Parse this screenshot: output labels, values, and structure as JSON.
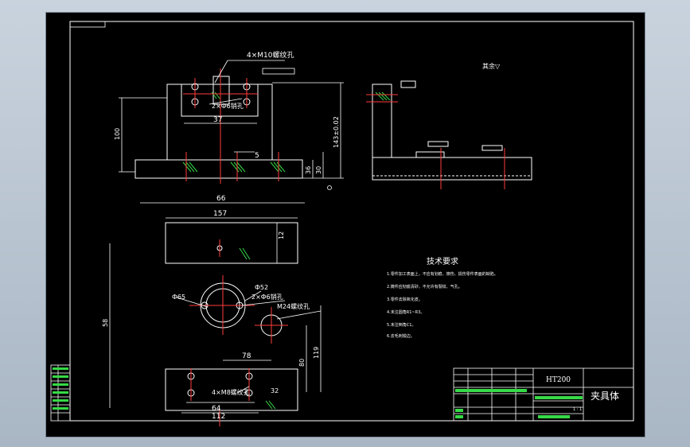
{
  "colors": {
    "background": "#000000",
    "part_outline": "#ffffff",
    "dimension": "#ffffff",
    "centerline": "#ff3b3b",
    "hatch": "#36d946",
    "annotation": "#ffffff",
    "title_block_green": "#36d946"
  },
  "front_view": {
    "callout_top_holes": "4×M10螺纹孔",
    "callout_pins": "2×Ф6销孔",
    "dim_width": "37",
    "dim_height": "100",
    "dim_overall_height": "143±0.02",
    "dim_step": "5",
    "dim_base_a": "36",
    "dim_base_b": "30"
  },
  "side_view": {
    "surface_mark": "其余▽"
  },
  "top_view": {
    "dim_overall_width": "66",
    "dim_slot_width": "157",
    "dim_slot_height": "12",
    "dim_bore": "Ф65",
    "dim_pin": "Ф52",
    "callout_pins": "2×Ф6销孔",
    "callout_m24": "M24螺纹孔",
    "dim_78": "78",
    "dim_overall_height": "58",
    "dim_80": "80",
    "dim_119": "119",
    "callout_bottom_holes": "4×M8螺纹孔",
    "dim_64": "64",
    "dim_112": "112",
    "dim_small": "32"
  },
  "tech_req": {
    "title": "技术要求",
    "lines": [
      "1.零件加工表面上，不应有划痕、擦伤、损伤零件表面的缺陷。",
      "2.铸件应彻底清砂，不允许有裂纹、气孔。",
      "3.零件去除氧化皮。",
      "4.未注圆角R1~R3。",
      "5.未注倒角C1。",
      "6.去毛刺锐边。"
    ]
  },
  "title_block": {
    "material": "HT200",
    "part_name": "夹具体",
    "sheet_info": "1 : 1"
  }
}
